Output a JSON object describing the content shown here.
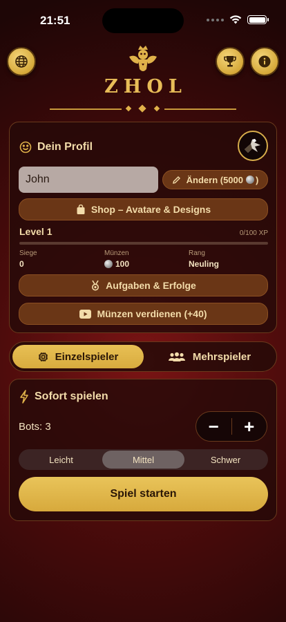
{
  "status_bar": {
    "time": "21:51"
  },
  "header": {
    "brand": "ZHOL"
  },
  "profile": {
    "title": "Dein Profil",
    "name_value": "John",
    "change_label": "Ändern (5000",
    "change_label_end": ")",
    "shop_label": "Shop – Avatare & Designs",
    "level_label": "Level 1",
    "xp_label": "0/100 XP",
    "xp_progress": 0,
    "stats": [
      {
        "key": "Siege",
        "value": "0"
      },
      {
        "key": "Münzen",
        "value": "100"
      },
      {
        "key": "Rang",
        "value": "Neuling"
      }
    ],
    "tasks_label": "Aufgaben & Erfolge",
    "earn_label": "Münzen verdienen (+40)"
  },
  "modes": {
    "single": "Einzelspieler",
    "multi": "Mehrspieler",
    "selected": "single"
  },
  "quick_play": {
    "title": "Sofort spielen",
    "bots_label": "Bots: 3",
    "minus": "−",
    "plus": "+",
    "difficulties": [
      "Leicht",
      "Mittel",
      "Schwer"
    ],
    "selected_difficulty": "Mittel",
    "start_label": "Spiel starten"
  },
  "colors": {
    "gold": "#e0b24a",
    "background": "#4a0b0b",
    "card": "#260a08"
  },
  "icons": [
    "globe-icon",
    "trophy-icon",
    "info-icon",
    "smiley-icon",
    "pencil-icon",
    "shopping-bag-icon",
    "medal-icon",
    "play-video-icon",
    "cpu-icon",
    "users-icon",
    "lightning-icon",
    "coin-icon"
  ]
}
